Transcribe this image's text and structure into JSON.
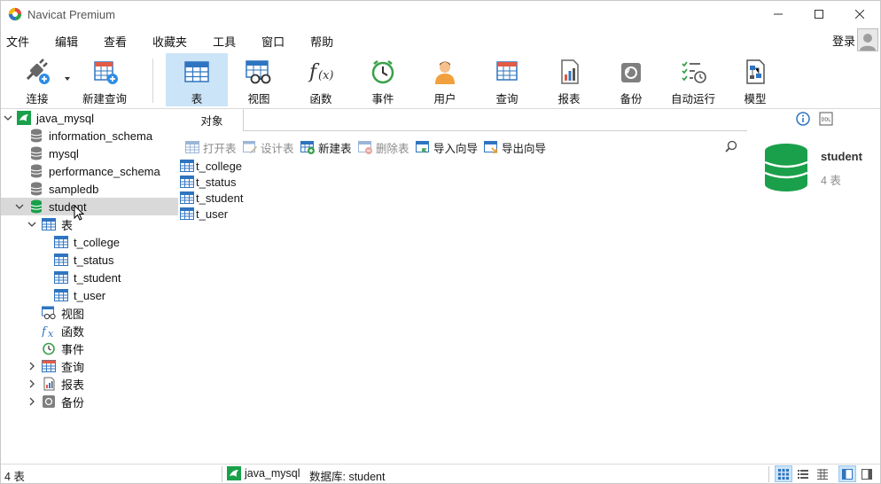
{
  "window": {
    "title": "Navicat Premium"
  },
  "menu": [
    "文件",
    "编辑",
    "查看",
    "收藏夹",
    "工具",
    "窗口",
    "帮助"
  ],
  "account": {
    "login_label": "登录"
  },
  "toolbar": {
    "connect": "连接",
    "new_query": "新建查询",
    "table": "表",
    "view": "视图",
    "function": "函数",
    "event": "事件",
    "user": "用户",
    "query": "查询",
    "report": "报表",
    "backup": "备份",
    "automation": "自动运行",
    "model": "模型"
  },
  "navigator": {
    "connection": "java_mysql",
    "databases": [
      "information_schema",
      "mysql",
      "performance_schema",
      "sampledb",
      "student"
    ],
    "selected_db": "student",
    "groups": {
      "tables": "表",
      "views": "视图",
      "functions": "函数",
      "events": "事件",
      "queries": "查询",
      "reports": "报表",
      "backups": "备份"
    },
    "tables": [
      "t_college",
      "t_status",
      "t_student",
      "t_user"
    ]
  },
  "objects_panel": {
    "tab_label": "对象",
    "actions": {
      "open_table": "打开表",
      "design_table": "设计表",
      "new_table": "新建表",
      "delete_table": "删除表",
      "import_wizard": "导入向导",
      "export_wizard": "导出向导"
    },
    "tables": [
      "t_college",
      "t_status",
      "t_student",
      "t_user"
    ]
  },
  "info_panel": {
    "db_name": "student",
    "table_count": "4 表",
    "ddl_label": "DDL"
  },
  "statusbar": {
    "count": "4 表",
    "connection": "java_mysql",
    "database": "数据库: student"
  },
  "colors": {
    "accent": "#cce4f7",
    "db_green": "#1aa04a",
    "table_blue": "#2f74c0",
    "selected_row": "#d9d9d9"
  }
}
